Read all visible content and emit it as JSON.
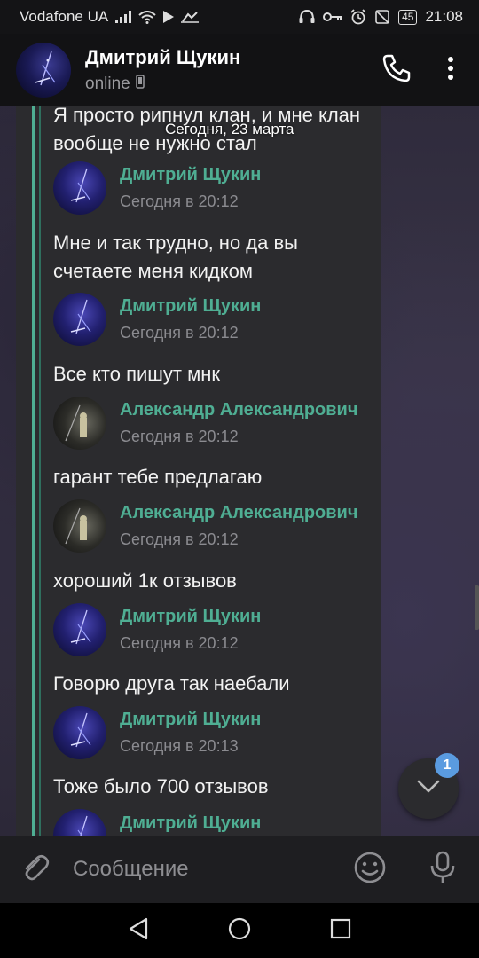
{
  "status_bar": {
    "carrier": "Vodafone UA",
    "battery": "45",
    "time": "21:08"
  },
  "header": {
    "name": "Дмитрий Щукин",
    "status": "online"
  },
  "chat": {
    "date_label": "Сегодня, 23 марта",
    "top_text": "Я просто рипнул клан,  и мне клан вообще не нужно стал",
    "messages": [
      {
        "author": "Дмитрий Щукин",
        "time": "Сегодня в 20:12",
        "text": "Мне и так трудно, но да вы счетаете меня кидком"
      },
      {
        "author": "Дмитрий Щукин",
        "time": "Сегодня в 20:12",
        "text": "Все кто пишут мнк"
      },
      {
        "author": "Александр Александрович",
        "time": "Сегодня в 20:12",
        "text": "гарант тебе предлагаю"
      },
      {
        "author": "Александр Александрович",
        "time": "Сегодня в 20:12",
        "text": "хороший 1к отзывов"
      },
      {
        "author": "Дмитрий Щукин",
        "time": "Сегодня в 20:12",
        "text": "Говорю друга так наебали"
      },
      {
        "author": "Дмитрий Щукин",
        "time": "Сегодня в 20:13",
        "text": "Тоже было 700 отзывов"
      },
      {
        "author": "Дмитрий Щукин",
        "time": "",
        "text": ""
      }
    ],
    "unread_badge": "1"
  },
  "input": {
    "placeholder": "Сообщение"
  },
  "icons": {
    "attach": "paperclip-icon",
    "emoji": "smile-icon",
    "mic": "microphone-icon",
    "call": "phone-icon",
    "menu": "more-vertical-icon",
    "scroll_down": "chevron-down-icon",
    "nav_back": "back-triangle-icon",
    "nav_home": "home-circle-icon",
    "nav_recents": "recents-square-icon"
  },
  "colors": {
    "accent": "#4fae93",
    "badge": "#5a9be0",
    "bubble": "#2b2b2e"
  }
}
